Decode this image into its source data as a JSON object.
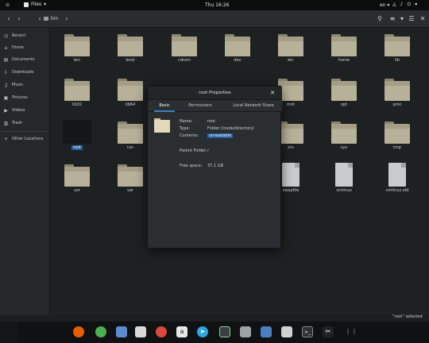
{
  "topbar": {
    "activities": "⊙",
    "app_name": "Files",
    "clock": "Thu 16:26",
    "input_method": "en",
    "tray_icons": [
      "network-icon",
      "volume-icon",
      "power-icon"
    ]
  },
  "header": {
    "path": "bin"
  },
  "sidebar": {
    "items": [
      {
        "icon": "clock-icon",
        "label": "Recent"
      },
      {
        "icon": "home-icon",
        "label": "Home"
      },
      {
        "icon": "document-icon",
        "label": "Documents"
      },
      {
        "icon": "download-icon",
        "label": "Downloads"
      },
      {
        "icon": "music-icon",
        "label": "Music"
      },
      {
        "icon": "picture-icon",
        "label": "Pictures"
      },
      {
        "icon": "video-icon",
        "label": "Videos"
      },
      {
        "icon": "trash-icon",
        "label": "Trash"
      }
    ],
    "other": {
      "icon": "plus-icon",
      "label": "Other Locations"
    }
  },
  "files": [
    {
      "name": "bin",
      "type": "folder"
    },
    {
      "name": "boot",
      "type": "folder"
    },
    {
      "name": "cdrom",
      "type": "folder"
    },
    {
      "name": "dev",
      "type": "folder"
    },
    {
      "name": "etc",
      "type": "folder"
    },
    {
      "name": "home",
      "type": "folder"
    },
    {
      "name": "lib",
      "type": "folder"
    },
    {
      "name": "lib32",
      "type": "folder"
    },
    {
      "name": "lib64",
      "type": "folder"
    },
    {
      "name": "mnt",
      "type": "folder"
    },
    {
      "name": "opt",
      "type": "folder"
    },
    {
      "name": "proc",
      "type": "folder"
    },
    {
      "name": "root",
      "type": "dark-folder"
    },
    {
      "name": "run",
      "type": "folder"
    },
    {
      "name": "srv",
      "type": "folder"
    },
    {
      "name": "sys",
      "type": "folder"
    },
    {
      "name": "tmp",
      "type": "folder"
    },
    {
      "name": "usr",
      "type": "folder"
    },
    {
      "name": "var",
      "type": "folder"
    },
    {
      "name": "swapfile",
      "type": "file"
    },
    {
      "name": "vmlinuz",
      "type": "file"
    },
    {
      "name": "vmlinuz.old",
      "type": "file"
    }
  ],
  "status": "“root” selected",
  "dialog": {
    "title": "root Properties",
    "tabs": [
      "Basic",
      "Permissions",
      "Local Network Share"
    ],
    "properties": {
      "name_label": "Name:",
      "name_value": "root",
      "type_label": "Type:",
      "type_value": "Folder (inode/directory)",
      "contents_label": "Contents:",
      "contents_value": "unreadable",
      "parent_label": "Parent Folder:",
      "parent_value": "/",
      "free_label": "Free space:",
      "free_value": "37.1 GB"
    }
  },
  "dock": {
    "apps": [
      "firefox-icon",
      "chrome-icon",
      "files-icon",
      "software-icon",
      "help-icon",
      "amazon-icon",
      "telegram-icon",
      "monitor-icon",
      "scanner-icon",
      "settings-icon",
      "screenshot-icon",
      "terminal-icon",
      "tools-icon",
      "app-grid-icon"
    ]
  }
}
